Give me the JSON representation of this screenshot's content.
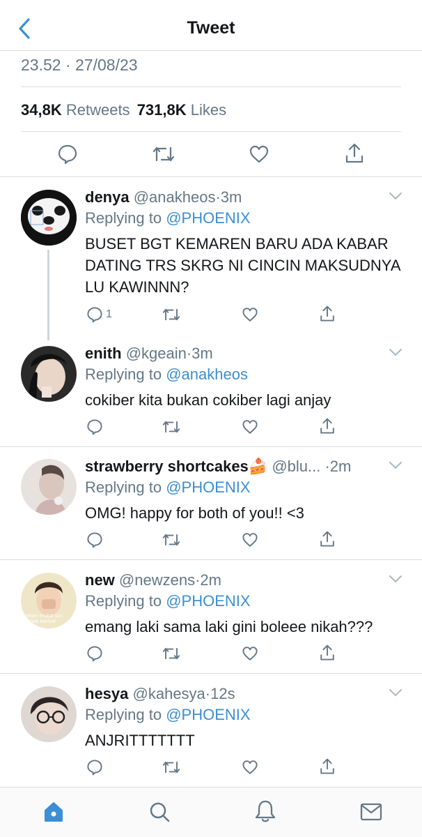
{
  "header": {
    "title": "Tweet"
  },
  "tweet": {
    "time": "23.52",
    "separator": "·",
    "date": "27/08/23",
    "retweet_count": "34,8K",
    "retweet_label": "Retweets",
    "like_count": "731,8K",
    "like_label": "Likes"
  },
  "replies": [
    {
      "name": "denya",
      "handle": "@anakheos",
      "time": "·3m",
      "replying_prefix": "Replying to",
      "replying_to": "@PHOENIX",
      "text": "BUSET BGT KEMAREN BARU ADA KABAR DATING TRS SKRG NI CINCIN MAKSUDNYA LU KAWINNN?",
      "reply_count": "1"
    },
    {
      "name": "enith",
      "handle": "@kgeain",
      "time": "·3m",
      "replying_prefix": "Replying to",
      "replying_to": "@anakheos",
      "text": "cokiber kita bukan cokiber lagi anjay"
    },
    {
      "name": "strawberry shortcakes🍰",
      "handle": "@blu...",
      "time": "·2m",
      "replying_prefix": "Replying to",
      "replying_to": "@PHOENIX",
      "text": "OMG! happy for both of you!! <3"
    },
    {
      "name": "new",
      "handle": "@newzens",
      "time": "·2m",
      "replying_prefix": "Replying to",
      "replying_to": "@PHOENIX",
      "text": "emang laki sama laki gini boleee nikah???",
      "avatar_text_1": "tahan mulut suc",
      "avatar_text_2": "tidak berkat"
    },
    {
      "name": "hesya",
      "handle": "@kahesya",
      "time": "·12s",
      "replying_prefix": "Replying to",
      "replying_to": "@PHOENIX",
      "text": "ANJRITTTTTTT"
    }
  ],
  "colors": {
    "accent": "#3b8fd4",
    "muted": "#657786",
    "divider": "#d8dde1"
  },
  "icons": [
    "back-chevron-icon",
    "reply-icon",
    "retweet-icon",
    "like-icon",
    "share-icon",
    "chevron-down-icon",
    "home-icon",
    "search-icon",
    "notifications-icon",
    "messages-icon"
  ]
}
